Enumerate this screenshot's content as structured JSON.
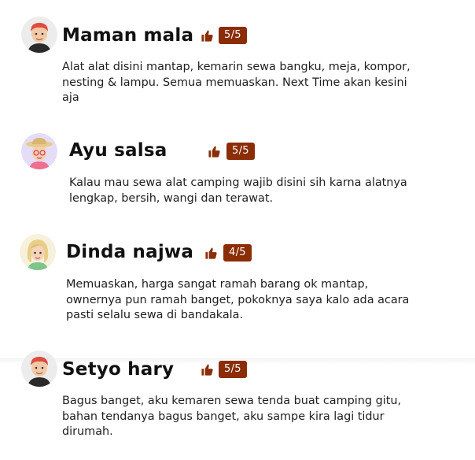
{
  "colors": {
    "badge_bg": "#8b2d06",
    "thumb": "#8b2d06"
  },
  "reviews": [
    {
      "name": "Maman mala",
      "rating": "5/5",
      "avatar_icon": "male-avatar-red-hair-icon",
      "text": "Alat alat disini mantap, kemarin sewa bangku, meja, kompor, nesting & lampu. Semua memuaskan. Next Time akan kesini aja"
    },
    {
      "name": "Ayu salsa",
      "rating": "5/5",
      "avatar_icon": "female-avatar-sunhat-icon",
      "text": "Kalau mau sewa alat camping wajib disini sih karna alatnya lengkap, bersih, wangi dan terawat."
    },
    {
      "name": "Dinda najwa",
      "rating": "4/5",
      "avatar_icon": "female-avatar-blonde-icon",
      "text": "Memuaskan, harga sangat ramah barang ok mantap, ownernya pun ramah banget, pokoknya saya kalo ada acara pasti selalu sewa di bandakala."
    },
    {
      "name": "Setyo hary",
      "rating": "5/5",
      "avatar_icon": "male-avatar-red-hair-icon",
      "text": "Bagus banget, aku kemaren sewa tenda buat camping gitu, bahan tendanya bagus banget, aku sampe kira lagi tidur dirumah."
    }
  ]
}
